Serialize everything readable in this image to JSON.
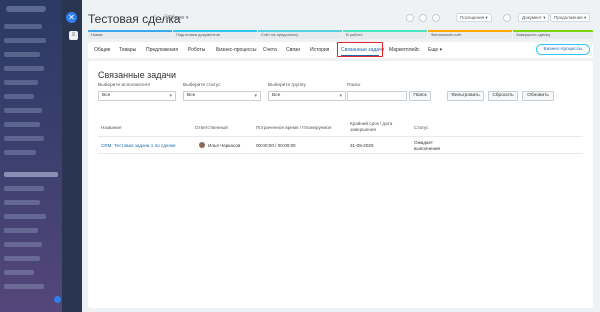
{
  "header": {
    "title": "Тестовая сделка",
    "common_dropdown": "Общие",
    "actions": {
      "dropdown1": "Посещения",
      "dropdown2": "Документ",
      "dropdown3": "Продолжение"
    }
  },
  "stages": [
    {
      "label": "Новая",
      "color": "#39a8ef"
    },
    {
      "label": "Подготовка документов",
      "color": "#2fc6f6"
    },
    {
      "label": "Счёт на предоплату",
      "color": "#55d0e0"
    },
    {
      "label": "В работе",
      "color": "#47e4c2"
    },
    {
      "label": "Финальный счёт",
      "color": "#ffa900"
    },
    {
      "label": "Завершить сделку",
      "color": "#7bd500"
    }
  ],
  "tabs": [
    {
      "label": "Общие"
    },
    {
      "label": "Товары"
    },
    {
      "label": "Предложения"
    },
    {
      "label": "Роботы"
    },
    {
      "label": "Бизнес-процессы"
    },
    {
      "label": "Счета"
    },
    {
      "label": "Связи"
    },
    {
      "label": "История"
    },
    {
      "label": "Связанные задачи"
    },
    {
      "label": "Маркетплейс"
    },
    {
      "label": "Еще ▾"
    }
  ],
  "bp_button": "Бизнес-процессы",
  "content": {
    "heading": "Связанные задачи",
    "filters": {
      "executor_label": "Выберите исполнителя",
      "executor_value": "Все",
      "status_label": "Выберите статус",
      "status_value": "Все",
      "group_label": "Выберите группу",
      "group_value": "Все",
      "search_label": "Поиск",
      "search_button": "Поиск",
      "filter_button": "Фильтровать",
      "reset_button": "Сбросить",
      "refresh_button": "Обновить"
    },
    "table": {
      "headers": {
        "name": "Название",
        "responsible": "Ответственный",
        "time": "Потраченное время / Планируемое",
        "deadline_line1": "Крайний срок / дата",
        "deadline_line2": "завершения",
        "status": "Статус"
      },
      "rows": [
        {
          "name": "CRM: Тестовая задача 1 по сделке",
          "responsible": "Илья Черкасов",
          "time": "00:00:00 / 00:00:00",
          "deadline": "31-05-2025",
          "status_line1": "Ожидает",
          "status_line2": "выполнения"
        }
      ]
    }
  }
}
